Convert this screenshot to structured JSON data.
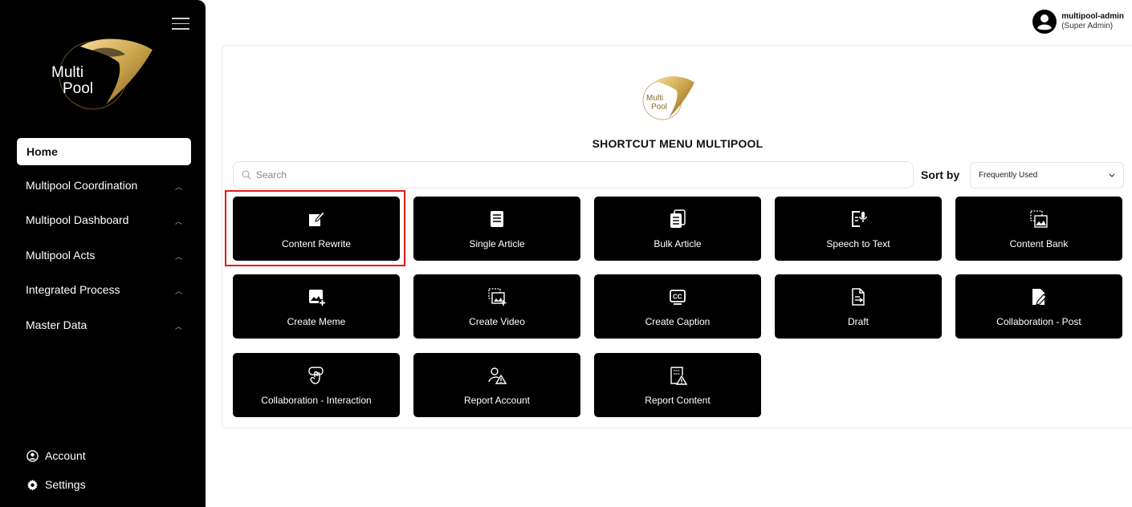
{
  "sidebar": {
    "logo_text_line1": "Multi",
    "logo_text_line2": "Pool",
    "home_label": "Home",
    "items": [
      {
        "label": "Multipool Coordination"
      },
      {
        "label": "Multipool Dashboard"
      },
      {
        "label": "Multipool Acts"
      },
      {
        "label": "Integrated Process"
      },
      {
        "label": "Master Data"
      }
    ],
    "account_label": "Account",
    "settings_label": "Settings"
  },
  "user": {
    "name": "multipool-admin",
    "role": "(Super Admin)"
  },
  "main": {
    "title": "SHORTCUT MENU MULTIPOOL",
    "search_placeholder": "Search",
    "sort_label": "Sort by",
    "sort_value": "Frequently Used",
    "tiles": [
      {
        "label": "Content Rewrite",
        "icon": "edit-icon"
      },
      {
        "label": "Single Article",
        "icon": "article-icon"
      },
      {
        "label": "Bulk Article",
        "icon": "bulk-article-icon"
      },
      {
        "label": "Speech to Text",
        "icon": "speech-to-text-icon"
      },
      {
        "label": "Content Bank",
        "icon": "image-bank-icon"
      },
      {
        "label": "Create Meme",
        "icon": "image-add-icon"
      },
      {
        "label": "Create Video",
        "icon": "video-add-icon"
      },
      {
        "label": "Create Caption",
        "icon": "cc-icon"
      },
      {
        "label": "Draft",
        "icon": "draft-icon"
      },
      {
        "label": "Collaboration - Post",
        "icon": "post-edit-icon"
      },
      {
        "label": "Collaboration - Interaction",
        "icon": "touch-icon"
      },
      {
        "label": "Report Account",
        "icon": "user-warning-icon"
      },
      {
        "label": "Report Content",
        "icon": "content-warning-icon"
      }
    ]
  },
  "colors": {
    "sidebar_bg": "#000000",
    "tile_bg": "#000000",
    "highlight": "#e31b1b",
    "logo_gold": "#c9a24a"
  }
}
